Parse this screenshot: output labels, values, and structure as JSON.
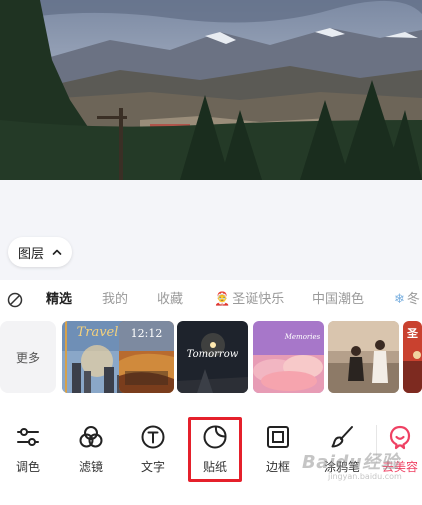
{
  "layer_button": {
    "label": "图层",
    "icon": "chevron-up-icon"
  },
  "tabs": [
    {
      "label": "",
      "icon": "no-sticker-icon"
    },
    {
      "label": "精选",
      "active": true
    },
    {
      "label": "我的"
    },
    {
      "label": "收藏"
    },
    {
      "label": "圣诞快乐",
      "icon": "santa-emoji"
    },
    {
      "label": "中国潮色"
    },
    {
      "label": "冬",
      "icon": "snowflake-emoji"
    }
  ],
  "stickers": {
    "more_label": "更多",
    "thumbs": [
      {
        "text": "Travel"
      },
      {
        "text": "12:12"
      },
      {
        "text": "Tomorrow"
      },
      {
        "text": "Memories"
      },
      {
        "text": ""
      },
      {
        "text": "圣"
      }
    ]
  },
  "tools": [
    {
      "label": "调色",
      "icon": "adjust-sliders-icon"
    },
    {
      "label": "滤镜",
      "icon": "filter-circles-icon"
    },
    {
      "label": "文字",
      "icon": "text-icon"
    },
    {
      "label": "贴纸",
      "icon": "sticker-icon",
      "highlighted": true
    },
    {
      "label": "边框",
      "icon": "frame-icon"
    },
    {
      "label": "涂鸦笔",
      "icon": "brush-icon"
    },
    {
      "label": "去美容",
      "icon": "beauty-app-icon"
    }
  ],
  "watermark": {
    "text": "Baidu经验",
    "sub": "jingyan.baidu.com"
  },
  "colors": {
    "highlight": "#e5202b",
    "brand": "#ef4163",
    "active_tab": "#222222",
    "inactive_tab": "#9a9a9a"
  }
}
